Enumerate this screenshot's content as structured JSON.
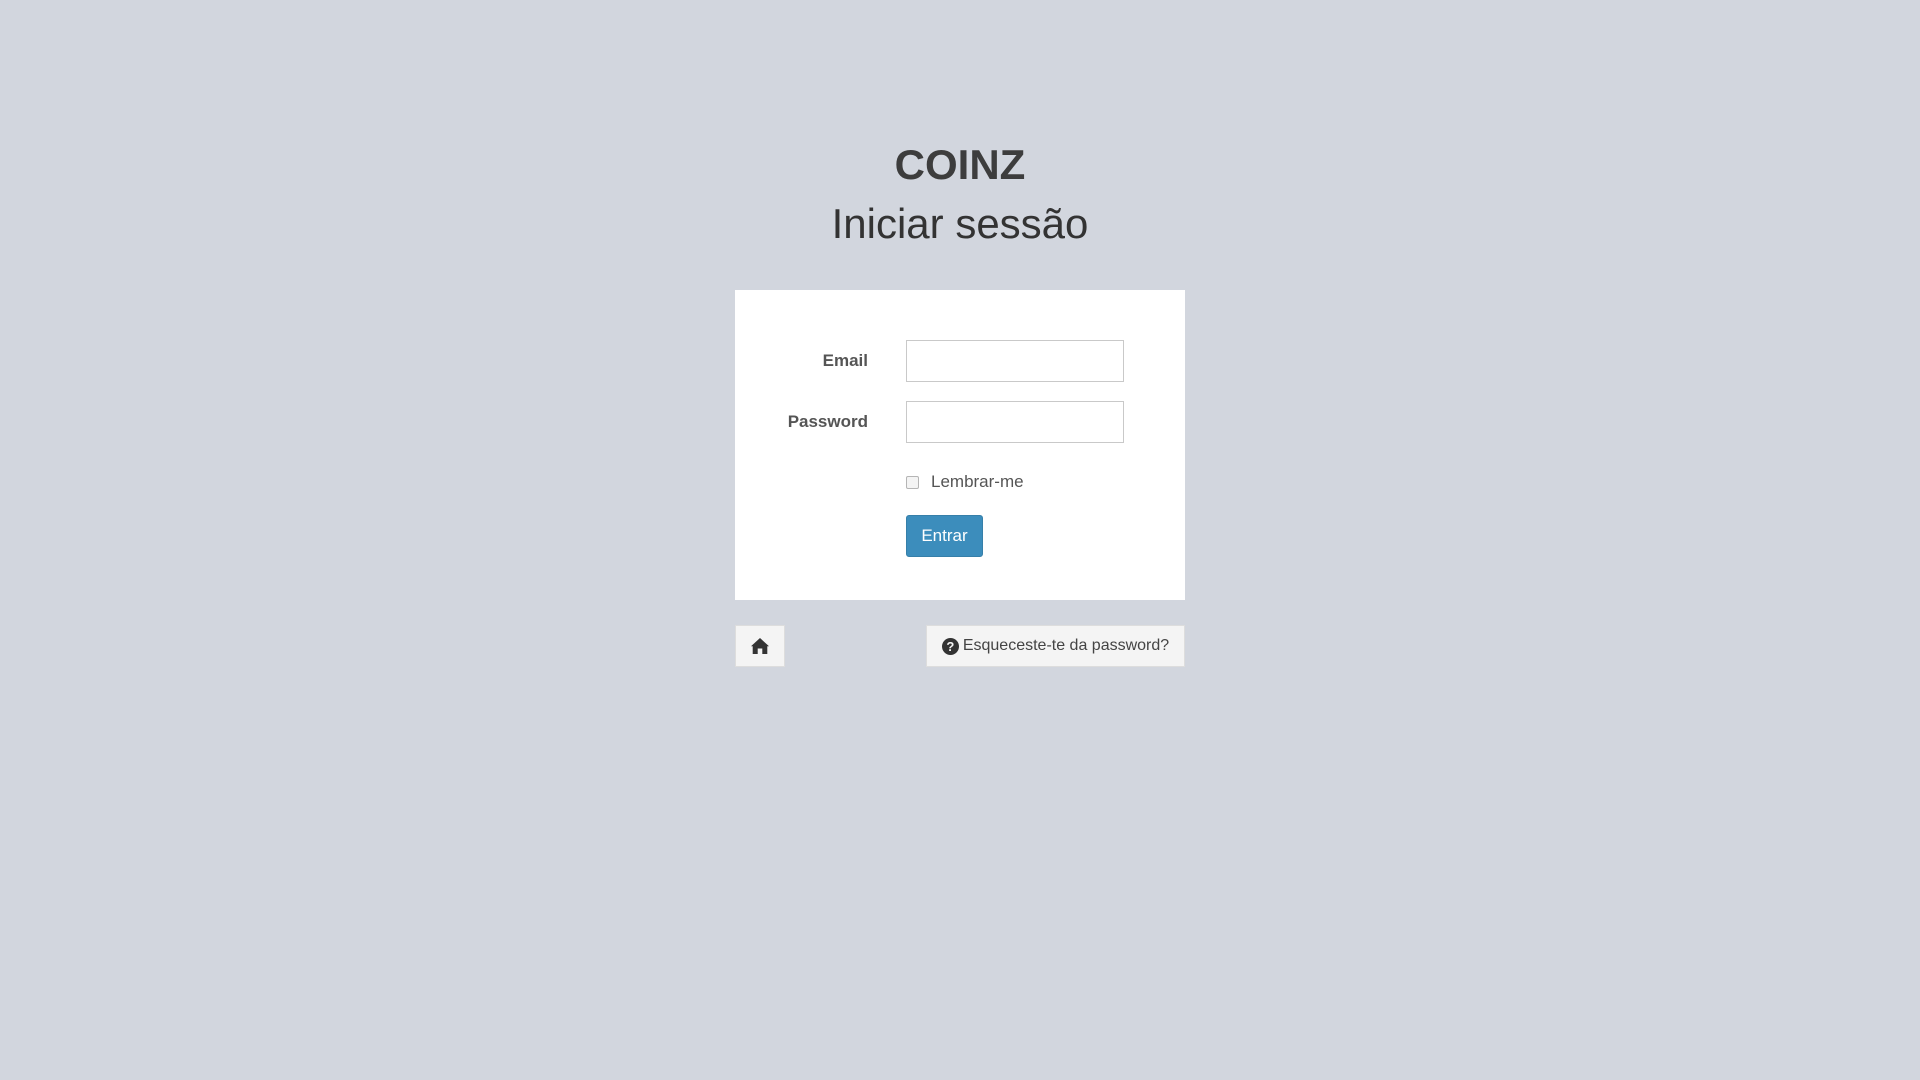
{
  "brand": {
    "name": "COINZ"
  },
  "page": {
    "title": "Iniciar sessão"
  },
  "form": {
    "email_label": "Email",
    "email_value": "",
    "password_label": "Password",
    "password_value": "",
    "remember_label": "Lembrar-me",
    "remember_checked": false,
    "submit_label": "Entrar"
  },
  "footer": {
    "home_icon": "home-icon",
    "forgot_icon": "question-circle-icon",
    "forgot_label": "Esqueceste-te da password?"
  },
  "colors": {
    "background": "#d2d6de",
    "primary": "#3c8dbc",
    "card": "#ffffff"
  }
}
